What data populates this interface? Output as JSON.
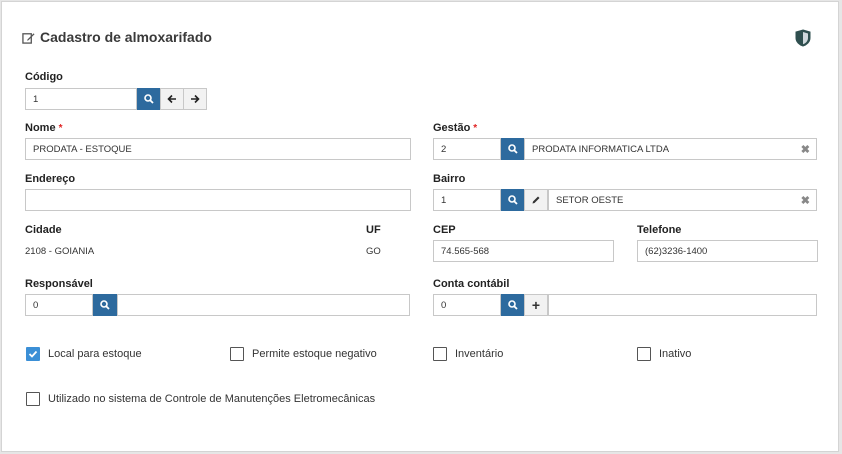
{
  "header": {
    "title": "Cadastro de almoxarifado",
    "edit_icon": "edit-icon",
    "shield_icon": "shield-icon"
  },
  "codigo": {
    "label": "Código",
    "value": "1"
  },
  "nome": {
    "label": "Nome",
    "required_mark": "*",
    "value": "PRODATA - ESTOQUE"
  },
  "gestao": {
    "label": "Gestão",
    "required_mark": "*",
    "code": "2",
    "name": "PRODATA INFORMATICA LTDA",
    "clear": "✖"
  },
  "endereco": {
    "label": "Endereço",
    "value": ""
  },
  "bairro": {
    "label": "Bairro",
    "code": "1",
    "name": "SETOR OESTE",
    "clear": "✖"
  },
  "cidade": {
    "label": "Cidade",
    "value": "2108 - GOIANIA"
  },
  "uf": {
    "label": "UF",
    "value": "GO"
  },
  "cep": {
    "label": "CEP",
    "value": "74.565-568"
  },
  "telefone": {
    "label": "Telefone",
    "value": "(62)3236-1400"
  },
  "responsavel": {
    "label": "Responsável",
    "code": "0",
    "name": ""
  },
  "conta_contabil": {
    "label": "Conta contábil",
    "code": "0",
    "name": "",
    "add": "+"
  },
  "checkboxes": {
    "local_estoque": {
      "label": "Local para estoque",
      "checked": true
    },
    "estoque_negativo": {
      "label": "Permite estoque negativo",
      "checked": false
    },
    "inventario": {
      "label": "Inventário",
      "checked": false
    },
    "inativo": {
      "label": "Inativo",
      "checked": false
    },
    "manutencoes": {
      "label": "Utilizado no sistema de Controle de Manutenções Eletromecânicas",
      "checked": false
    }
  },
  "colors": {
    "primary_button": "#2d6a9e",
    "checkbox_checked": "#3b8fd6",
    "required": "#e02424"
  }
}
